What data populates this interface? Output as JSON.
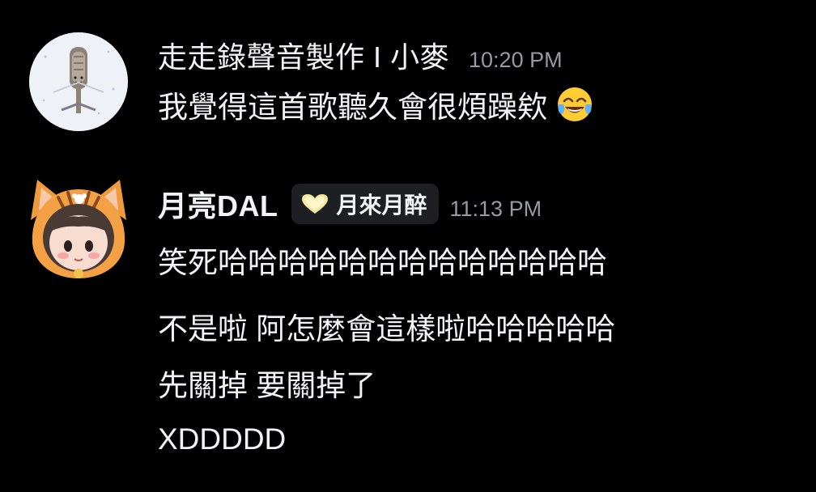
{
  "messages": [
    {
      "author": "走走錄聲音製作 I 小麥",
      "time": "10:20 PM",
      "lines": [
        "我覺得這首歌聽久會很煩躁欸"
      ],
      "emoji": "face-with-tears-of-joy",
      "avatar": "microphone-avatar"
    },
    {
      "author": "月亮DAL",
      "tag": {
        "label": "月來月醉",
        "icon": "yellow-heart-icon"
      },
      "time": "11:13 PM",
      "lines": [
        "笑死哈哈哈哈哈哈哈哈哈哈哈哈哈",
        "不是啦 阿怎麼會這樣啦哈哈哈哈哈",
        "先關掉 要關掉了",
        "XDDDDD"
      ],
      "avatar": "tiger-hood-girl-avatar"
    }
  ]
}
